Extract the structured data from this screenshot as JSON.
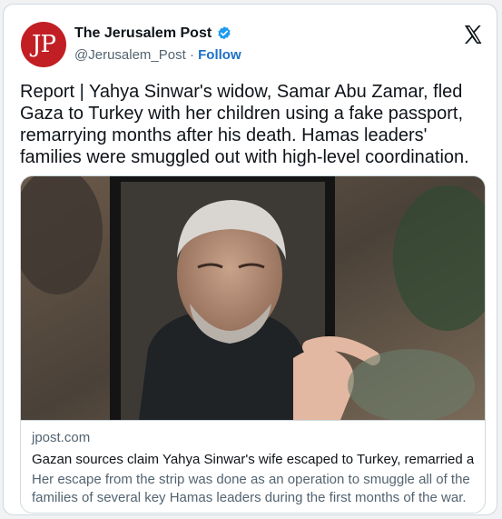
{
  "author": {
    "avatar_text": "JP",
    "name": "The Jerusalem Post",
    "handle": "@Jerusalem_Post",
    "separator": "·",
    "follow_label": "Follow",
    "verified_icon": "verified-badge-icon",
    "verified_color": "#1d9bf0"
  },
  "platform_logo": "x-logo-icon",
  "tweet": {
    "text": "Report | Yahya Sinwar's widow, Samar Abu Zamar, fled Gaza to Turkey with her children using a fake passport, remarrying months after his death. Hamas leaders' families were smuggled out with high-level coordination."
  },
  "link_card": {
    "domain": "jpost.com",
    "title": "Gazan sources claim Yahya Sinwar's wife escaped to Turkey, remarried af...",
    "description": "Her escape from the strip was done as an operation to smuggle all of the families of several key Hamas leaders during the first months of the war."
  },
  "colors": {
    "brand_red": "#c21f24",
    "link_blue": "#1d6fc7",
    "text_primary": "#0f1419",
    "text_secondary": "#536471"
  }
}
